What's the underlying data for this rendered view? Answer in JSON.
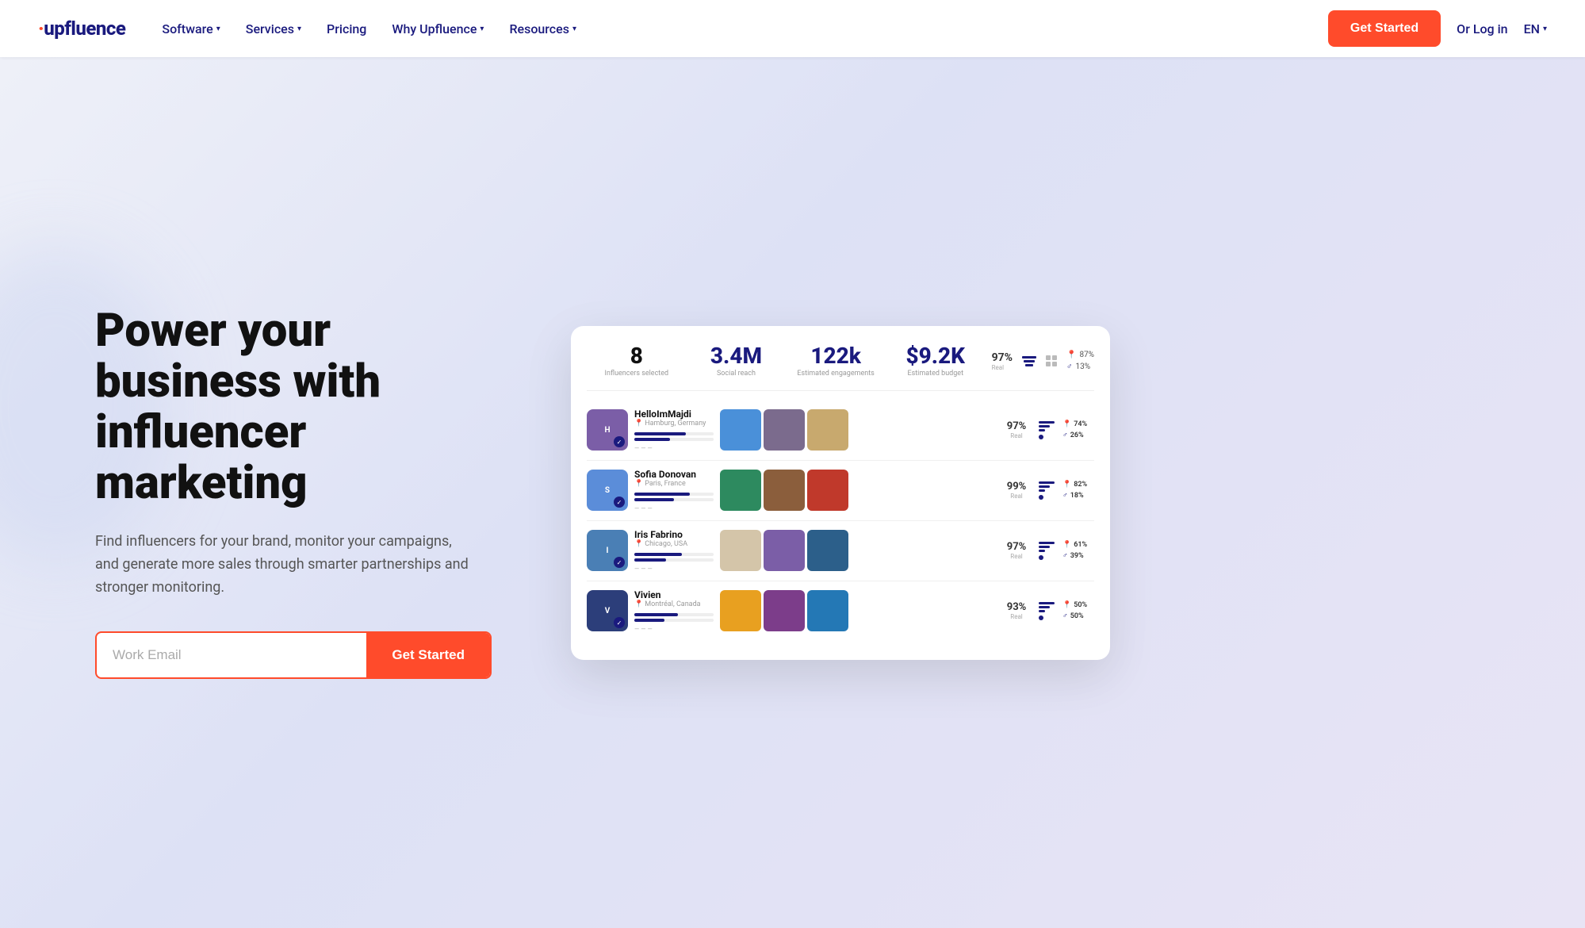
{
  "brand": {
    "name": "upfluence",
    "dot_char": "·"
  },
  "nav": {
    "software_label": "Software",
    "services_label": "Services",
    "pricing_label": "Pricing",
    "why_label": "Why Upfluence",
    "resources_label": "Resources",
    "get_started_label": "Get Started",
    "login_label": "Or Log in",
    "lang_label": "EN"
  },
  "hero": {
    "title": "Power your business with influencer marketing",
    "subtitle": "Find influencers for your brand, monitor your campaigns, and generate more sales through smarter partnerships and stronger monitoring.",
    "email_placeholder": "Work Email",
    "cta_label": "Get Started"
  },
  "dashboard": {
    "stats": {
      "influencers": {
        "value": "8",
        "label": "Influencers selected"
      },
      "reach": {
        "value": "3.4M",
        "label": "Social reach"
      },
      "engagements": {
        "value": "122k",
        "label": "Estimated engagements"
      },
      "budget": {
        "value": "$9.2K",
        "label": "Estimated budget"
      },
      "real_pct": "97%",
      "real_lbl": "Real",
      "gender_pct": "13%",
      "gender_lbl": "",
      "location_pct": "87%",
      "gender2_pct": "13%"
    },
    "influencers": [
      {
        "name": "HelloImMajdi",
        "location": "Hamburg, Germany",
        "avatar_color": "#7b5ea7",
        "real_score": "97%",
        "loc_pct": "74%",
        "gen_pct": "26%",
        "photos": [
          "#4a90d9",
          "#8b6f47",
          "#d4a574"
        ],
        "bars": [
          65,
          45,
          30
        ]
      },
      {
        "name": "Sofia Donovan",
        "location": "Paris, France",
        "avatar_color": "#5b8dd9",
        "real_score": "99%",
        "loc_pct": "82%",
        "gen_pct": "18%",
        "photos": [
          "#2d6a4f",
          "#8b4513",
          "#c0392b"
        ],
        "bars": [
          70,
          50,
          30
        ]
      },
      {
        "name": "Iris Fabrino",
        "location": "Chicago, USA",
        "avatar_color": "#4a7fb5",
        "real_score": "97%",
        "loc_pct": "61%",
        "gen_pct": "39%",
        "photos": [
          "#e8d5b7",
          "#6c5b7b",
          "#355c7d"
        ],
        "bars": [
          60,
          40,
          25
        ]
      },
      {
        "name": "Vivien",
        "location": "Montréal, Canada",
        "avatar_color": "#2c3e7a",
        "real_score": "93%",
        "loc_pct": "50%",
        "gen_pct": "50%",
        "photos": [
          "#f39c12",
          "#8e44ad",
          "#2980b9"
        ],
        "bars": [
          55,
          38,
          22
        ]
      }
    ]
  }
}
